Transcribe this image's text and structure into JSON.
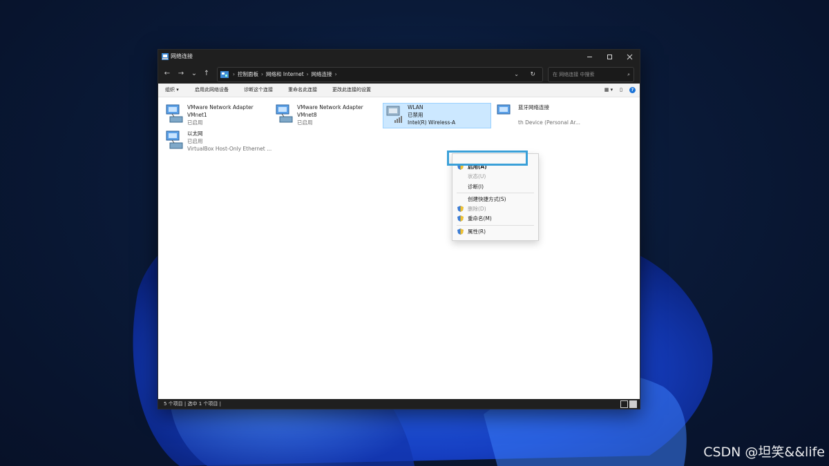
{
  "window": {
    "title": "网络连接",
    "controls": [
      "minimize",
      "maximize",
      "close"
    ]
  },
  "navigation": {
    "breadcrumbs": [
      "控制面板",
      "网络和 Internet",
      "网络连接"
    ],
    "search_placeholder": "在 网络连接 中搜索"
  },
  "commands": {
    "organize": "组织 ▾",
    "enable_device": "启用此网络设备",
    "diagnose": "诊断这个连接",
    "rename": "重命名此连接",
    "change_settings": "更改此连接的设置"
  },
  "items": [
    {
      "name": "VMware Network Adapter",
      "line2": "VMnet1",
      "status": "已启用",
      "icon": "network-adapter-icon"
    },
    {
      "name": "VMware Network Adapter",
      "line2": "VMnet8",
      "status": "已启用",
      "icon": "network-adapter-icon"
    },
    {
      "name": "WLAN",
      "line2": "已禁用",
      "status": "Intel(R) Wireless-A",
      "icon": "wireless-adapter-icon"
    },
    {
      "name": "蓝牙网络连接",
      "status": "th Device (Personal Ar...",
      "icon": "bluetooth-adapter-icon"
    },
    {
      "name": "以太网",
      "line2": "已启用",
      "status": "VirtualBox Host-Only Ethernet ...",
      "icon": "network-adapter-icon"
    }
  ],
  "context_menu": {
    "items": [
      {
        "label": "启用(A)",
        "shield": true,
        "disabled": false,
        "bold": true
      },
      {
        "label": "状态(U)",
        "shield": false,
        "disabled": true
      },
      {
        "label": "诊断(I)",
        "shield": false,
        "disabled": false
      },
      {
        "label": "创建快捷方式(S)",
        "shield": false,
        "disabled": false
      },
      {
        "label": "删除(D)",
        "shield": true,
        "disabled": true
      },
      {
        "label": "重命名(M)",
        "shield": true,
        "disabled": false
      },
      {
        "label": "属性(R)",
        "shield": true,
        "disabled": false
      }
    ]
  },
  "statusbar": {
    "text": "5 个项目  |  选中 1 个项目  |"
  },
  "watermark": "CSDN @坦笑&&life",
  "colors": {
    "titlebar": "#1f1f1f",
    "selection": "#cce8ff",
    "highlight_box": "#3aa0d8",
    "wallpaper": "#0a1a38"
  }
}
